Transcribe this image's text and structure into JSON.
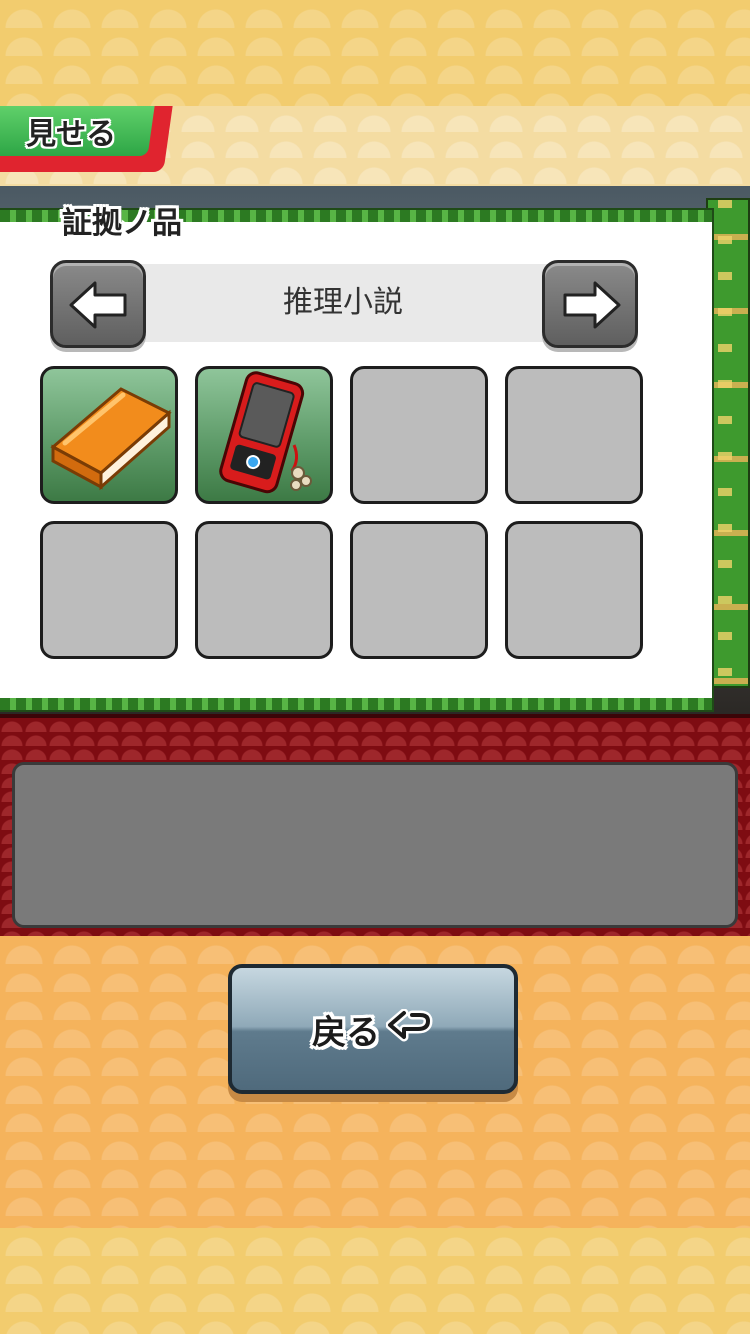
{
  "header": {
    "show_label": "見せる"
  },
  "panel": {
    "title": "証拠ノ品",
    "category_label": "推理小説",
    "items": [
      {
        "icon": "book-icon",
        "filled": true
      },
      {
        "icon": "red-phone-icon",
        "filled": true
      },
      {
        "icon": "",
        "filled": false
      },
      {
        "icon": "",
        "filled": false
      },
      {
        "icon": "",
        "filled": false
      },
      {
        "icon": "",
        "filled": false
      },
      {
        "icon": "",
        "filled": false
      },
      {
        "icon": "",
        "filled": false
      }
    ]
  },
  "description": {
    "text": ""
  },
  "footer": {
    "back_label": "戻る"
  },
  "colors": {
    "panel_green": "#3a8a2a",
    "desc_red": "#7e0c12",
    "lower_orange": "#f5b35c",
    "tab_red": "#e0242f",
    "tab_green": "#2da646"
  }
}
